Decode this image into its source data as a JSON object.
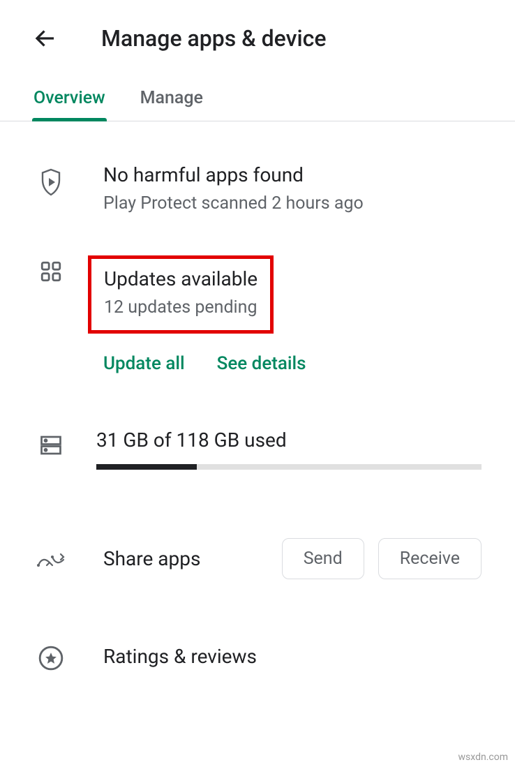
{
  "header": {
    "title": "Manage apps & device"
  },
  "tabs": {
    "overview": "Overview",
    "manage": "Manage"
  },
  "protect": {
    "title": "No harmful apps found",
    "subtitle": "Play Protect scanned 2 hours ago"
  },
  "updates": {
    "title": "Updates available",
    "subtitle": "12 updates pending",
    "update_all": "Update all",
    "see_details": "See details"
  },
  "storage": {
    "text": "31 GB of 118 GB used"
  },
  "share": {
    "title": "Share apps",
    "send": "Send",
    "receive": "Receive"
  },
  "ratings": {
    "title": "Ratings & reviews"
  },
  "watermark": "wsxdn.com"
}
